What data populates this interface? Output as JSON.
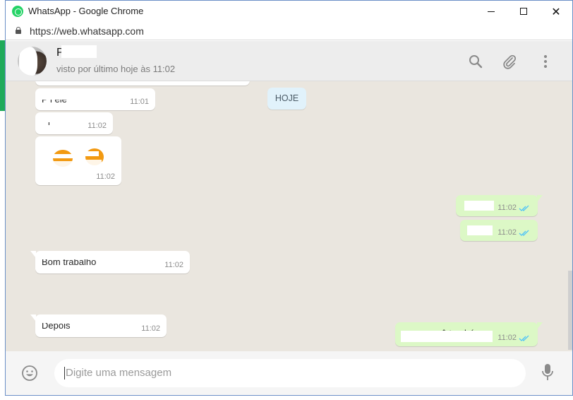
{
  "window": {
    "title": "WhatsApp - Google Chrome",
    "url": "https://web.whatsapp.com"
  },
  "chat": {
    "contact_name": "P  i  il",
    "last_seen": "visto por último hoje às 11:02",
    "date_label": "HOJE"
  },
  "messages": [
    {
      "direction": "in",
      "text": "P  i      ele",
      "time": "11:01"
    },
    {
      "direction": "in",
      "text": "i",
      "time": "11:02"
    },
    {
      "direction": "in",
      "text": "",
      "time": "11:02",
      "kind": "emoji"
    },
    {
      "direction": "out",
      "text": "",
      "time": "11:02",
      "status": "read"
    },
    {
      "direction": "out",
      "text": "",
      "time": "11:02",
      "status": "read"
    },
    {
      "direction": "in",
      "text": "Bom trabalho",
      "time": "11:02"
    },
    {
      "direction": "out",
      "text": "cê também",
      "time": "11:02",
      "status": "read"
    },
    {
      "direction": "in",
      "text": "Depois",
      "time": "11:02"
    }
  ],
  "compose": {
    "placeholder": "Digite uma mensagem"
  },
  "icons": {
    "search": "search-icon",
    "attach": "paperclip-icon",
    "menu": "more-vertical-icon",
    "emoji": "emoji-icon",
    "mic": "microphone-icon"
  },
  "colors": {
    "outgoing_bubble": "#dcf8c6",
    "incoming_bubble": "#ffffff",
    "chat_background": "#eae6df",
    "read_ticks": "#4fc3f7",
    "brand": "#25d366"
  }
}
